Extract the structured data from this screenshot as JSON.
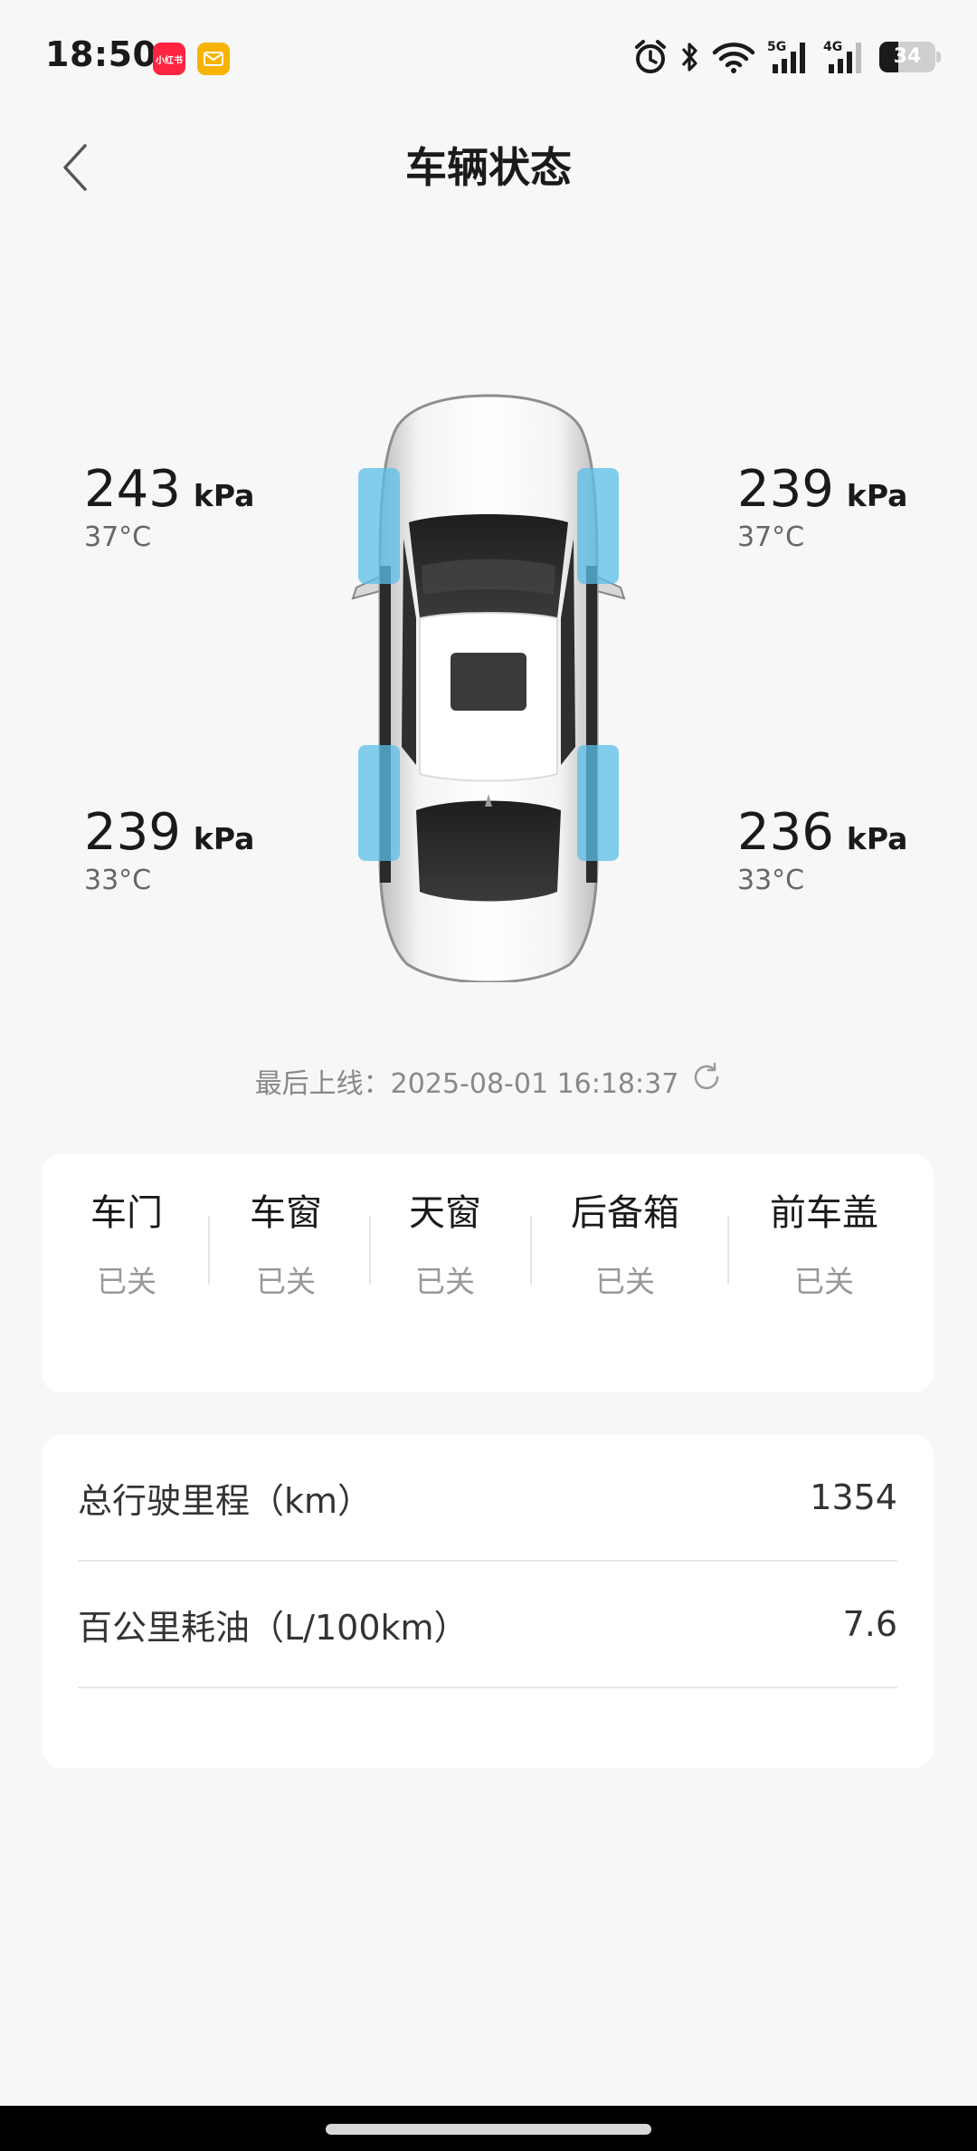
{
  "status_bar": {
    "time": "18:50",
    "badge1_text": "小红书",
    "battery_level": "34",
    "icons": [
      "alarm-icon",
      "bluetooth-icon",
      "wifi-icon",
      "5g-signal-icon",
      "4g-signal-icon",
      "battery-icon"
    ]
  },
  "header": {
    "title": "车辆状态",
    "back_icon": "chevron-left-icon"
  },
  "tires": {
    "front_left": {
      "pressure": "243",
      "unit": "kPa",
      "temp": "37°C"
    },
    "front_right": {
      "pressure": "239",
      "unit": "kPa",
      "temp": "37°C"
    },
    "rear_left": {
      "pressure": "239",
      "unit": "kPa",
      "temp": "33°C"
    },
    "rear_right": {
      "pressure": "236",
      "unit": "kPa",
      "temp": "33°C"
    }
  },
  "last_online": {
    "text": "最后上线：2025-08-01 16:18:37",
    "refresh_icon": "refresh-icon"
  },
  "body_status": {
    "items": [
      {
        "label": "车门",
        "value": "已关"
      },
      {
        "label": "车窗",
        "value": "已关"
      },
      {
        "label": "天窗",
        "value": "已关"
      },
      {
        "label": "后备箱",
        "value": "已关"
      },
      {
        "label": "前车盖",
        "value": "已关"
      }
    ]
  },
  "stats": {
    "rows": [
      {
        "label": "总行驶里程（km）",
        "value": "1354"
      },
      {
        "label": "百公里耗油（L/100km）",
        "value": "7.6"
      }
    ]
  },
  "colors": {
    "background": "#f7f7f7",
    "card": "#ffffff",
    "tire_highlight": "#5bbfea",
    "muted_text": "#999999"
  }
}
